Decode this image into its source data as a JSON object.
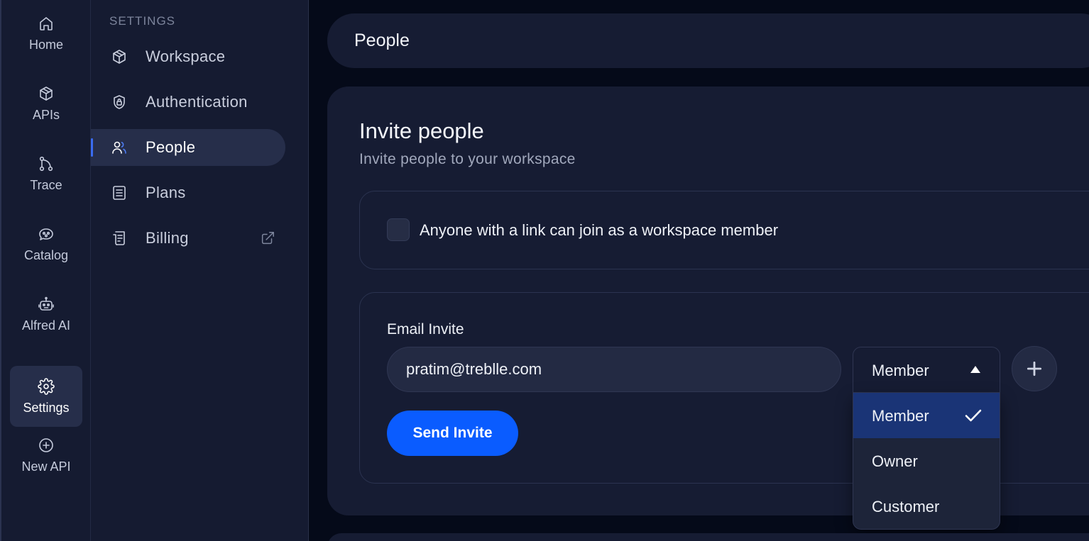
{
  "rail": {
    "items": [
      {
        "label": "Home",
        "icon": "home-icon"
      },
      {
        "label": "APIs",
        "icon": "cube-icon"
      },
      {
        "label": "Trace",
        "icon": "trace-icon"
      },
      {
        "label": "Catalog",
        "icon": "catalog-icon"
      },
      {
        "label": "Alfred AI",
        "icon": "robot-icon"
      },
      {
        "label": "Settings",
        "icon": "gear-icon",
        "active": true
      },
      {
        "label": "New API",
        "icon": "plus-circle-icon"
      }
    ]
  },
  "settings_nav": {
    "heading": "SETTINGS",
    "items": [
      {
        "label": "Workspace",
        "icon": "cube-icon"
      },
      {
        "label": "Authentication",
        "icon": "shield-lock-icon"
      },
      {
        "label": "People",
        "icon": "users-icon",
        "active": true
      },
      {
        "label": "Plans",
        "icon": "document-icon"
      },
      {
        "label": "Billing",
        "icon": "receipt-icon",
        "external_icon": "external-link-icon"
      }
    ]
  },
  "header": {
    "title": "People"
  },
  "invite": {
    "title": "Invite people",
    "subtitle": "Invite people to your workspace",
    "link_join_label": "Anyone with a link can join as a workspace member",
    "link_join_checked": false,
    "email_label": "Email Invite",
    "email_value": "pratim@treblle.com",
    "send_label": "Send Invite",
    "role": {
      "selected": "Member",
      "options": [
        "Member",
        "Owner",
        "Customer"
      ]
    }
  },
  "colors": {
    "accent": "#0a5cff",
    "selected_option": "#1a3476",
    "background": "#050a19",
    "panel": "#161c33"
  }
}
